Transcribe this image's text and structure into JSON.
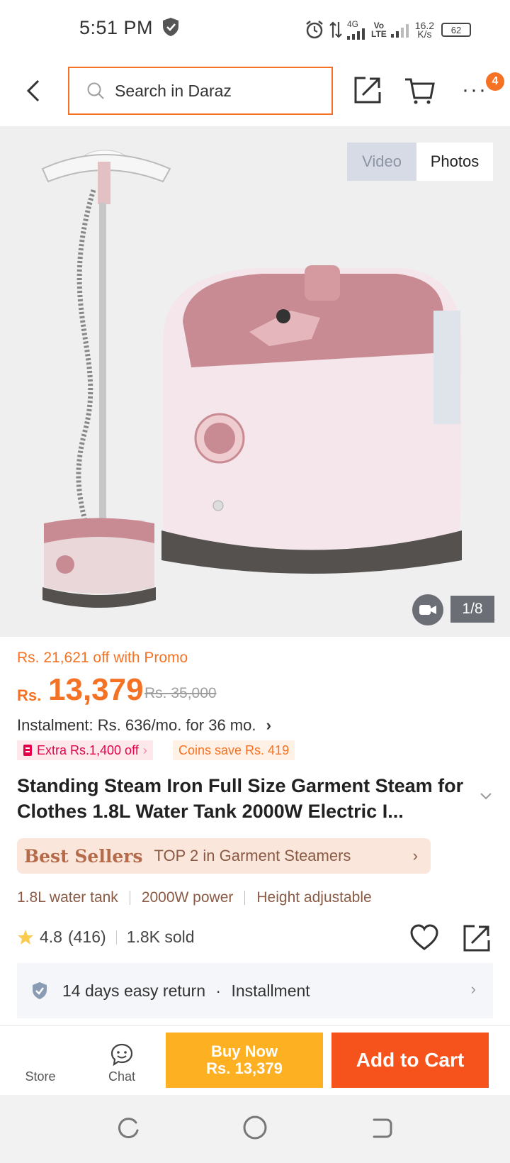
{
  "status_bar": {
    "time": "5:51 PM",
    "network_4g": "4G",
    "volte_top": "Vo",
    "volte_bottom": "LTE",
    "speed_top": "16.2",
    "speed_bottom": "K/s",
    "battery": "62"
  },
  "header": {
    "search_placeholder": "Search in Daraz",
    "cart_badge": "4"
  },
  "gallery": {
    "tab_video": "Video",
    "tab_photos": "Photos",
    "counter": "1/8",
    "product_colors": {
      "body": "#f1dfe3",
      "accent": "#c98b93",
      "base": "#55514f"
    }
  },
  "price": {
    "promo_text": "Rs. 21,621 off with Promo",
    "currency": "Rs.",
    "current": "13,379",
    "original": "Rs. 35,000",
    "instalment": "Instalment: Rs. 636/mo. for 36 mo.",
    "extra_off": "Extra Rs.1,400 off",
    "coins": "Coins save Rs. 419"
  },
  "product": {
    "title": "Standing Steam Iron Full Size Garment Steam for Clothes 1.8L Water Tank 2000W Electric I...",
    "best_sellers_label": "Best Sellers",
    "best_sellers_rank": "TOP 2 in Garment Steamers",
    "features": [
      "1.8L water tank",
      "2000W power",
      "Height adjustable"
    ],
    "rating": "4.8",
    "reviews": "(416)",
    "sold": "1.8K sold"
  },
  "service": {
    "returns": "14 days easy return",
    "dot": "·",
    "installment": "Installment"
  },
  "bottom_bar": {
    "store": "Store",
    "chat": "Chat",
    "buy_now_line1": "Buy Now",
    "buy_now_line2": "Rs. 13,379",
    "add_to_cart": "Add to Cart"
  },
  "colors": {
    "brand": "#f57224",
    "buy_now": "#fdb022",
    "add_to_cart": "#f6531c"
  }
}
